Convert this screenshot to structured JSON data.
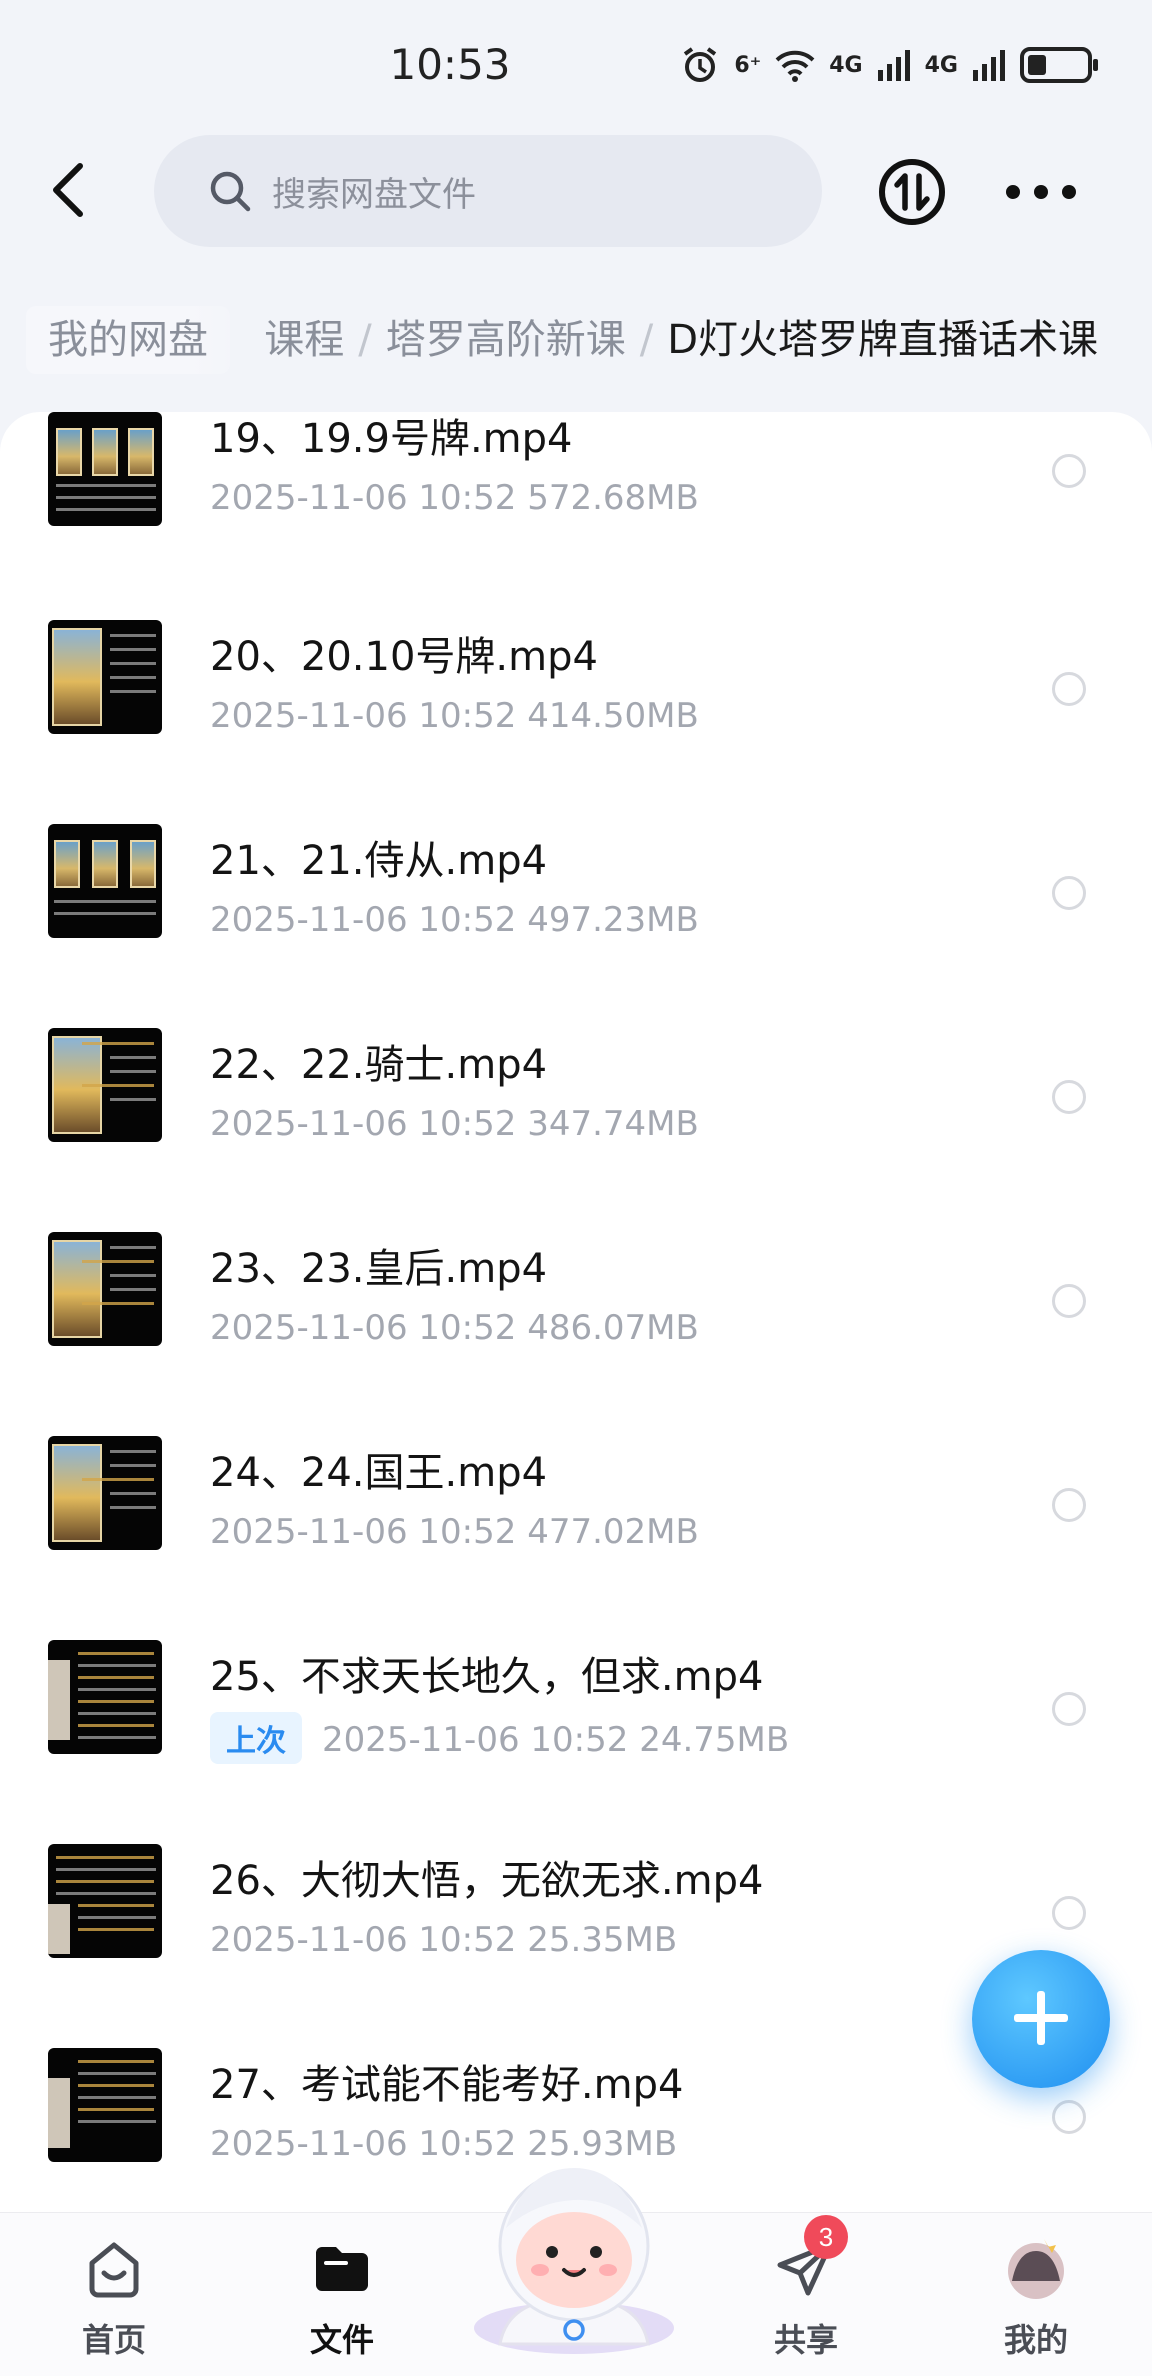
{
  "status_bar": {
    "time": "10:53",
    "network_1": "6⁺",
    "network_2": "4G",
    "network_3": "4G"
  },
  "search": {
    "placeholder": "搜索网盘文件"
  },
  "breadcrumb": {
    "root": "我的网盘",
    "partial": "课程",
    "level2": "塔罗高阶新课",
    "current": "D灯火塔罗牌直播话术课"
  },
  "files": [
    {
      "name": "19、19.9号牌.mp4",
      "date": "2025-11-06",
      "time": "10:52",
      "size": "572.68MB",
      "last": ""
    },
    {
      "name": "20、20.10号牌.mp4",
      "date": "2025-11-06",
      "time": "10:52",
      "size": "414.50MB",
      "last": ""
    },
    {
      "name": "21、21.侍从.mp4",
      "date": "2025-11-06",
      "time": "10:52",
      "size": "497.23MB",
      "last": ""
    },
    {
      "name": "22、22.骑士.mp4",
      "date": "2025-11-06",
      "time": "10:52",
      "size": "347.74MB",
      "last": ""
    },
    {
      "name": "23、23.皇后.mp4",
      "date": "2025-11-06",
      "time": "10:52",
      "size": "486.07MB",
      "last": ""
    },
    {
      "name": "24、24.国王.mp4",
      "date": "2025-11-06",
      "time": "10:52",
      "size": "477.02MB",
      "last": ""
    },
    {
      "name": "25、不求天长地久，但求.mp4",
      "date": "2025-11-06",
      "time": "10:52",
      "size": "24.75MB",
      "last": "上次"
    },
    {
      "name": "26、大彻大悟，无欲无求.mp4",
      "date": "2025-11-06",
      "time": "10:52",
      "size": "25.35MB",
      "last": ""
    },
    {
      "name": "27、考试能不能考好.mp4",
      "date": "2025-11-06",
      "time": "10:52",
      "size": "25.93MB",
      "last": ""
    }
  ],
  "nav": {
    "home": "首页",
    "files": "文件",
    "share": "共享",
    "share_badge": "3",
    "me": "我的"
  },
  "colors": {
    "accent": "#1e8ef0",
    "badge": "#f04a5a"
  }
}
